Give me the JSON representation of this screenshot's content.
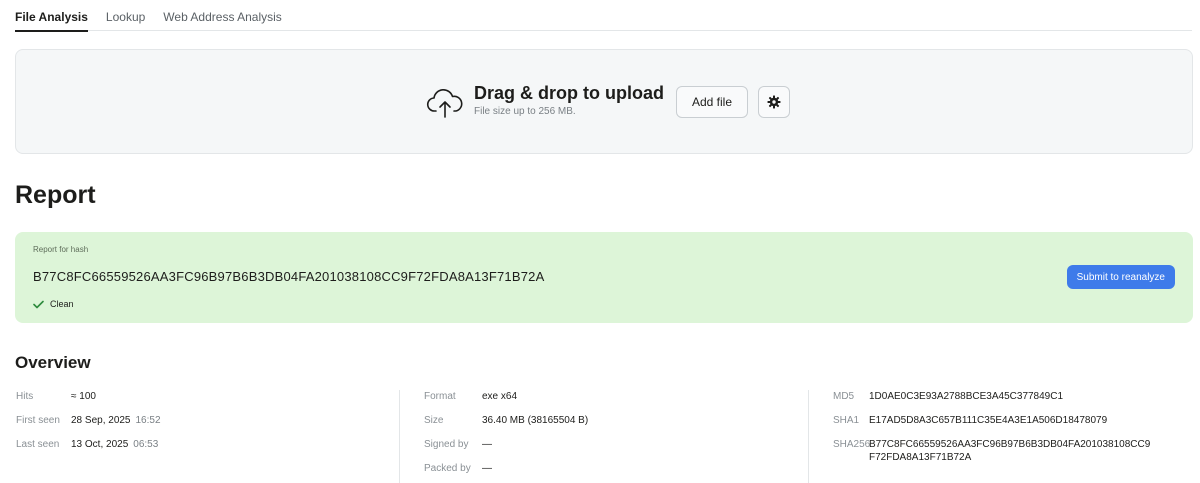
{
  "tabs": [
    {
      "label": "File Analysis",
      "active": true
    },
    {
      "label": "Lookup",
      "active": false
    },
    {
      "label": "Web Address Analysis",
      "active": false
    }
  ],
  "upload": {
    "title": "Drag & drop to upload",
    "subtitle": "File size up to 256 MB.",
    "add_file_label": "Add file",
    "icon": "cloud-upload-icon",
    "settings_icon": "gear-icon"
  },
  "report": {
    "title": "Report",
    "card_label": "Report for hash",
    "hash": "B77C8FC66559526AA3FC96B97B6B3DB04FA201038108CC9F72FDA8A13F71B72A",
    "status": "Clean",
    "reanalyze_label": "Submit to reanalyze",
    "card_color": "#ddf5d8",
    "accent_color": "#3e7bea"
  },
  "overview": {
    "title": "Overview",
    "col1": {
      "hits_label": "Hits",
      "hits_value": "≈ 100",
      "first_seen_label": "First seen",
      "first_seen_date": "28 Sep, 2025",
      "first_seen_time": "16:52",
      "last_seen_label": "Last seen",
      "last_seen_date": "13 Oct, 2025",
      "last_seen_time": "06:53"
    },
    "col2": {
      "format_label": "Format",
      "format_value": "exe x64",
      "size_label": "Size",
      "size_value": "36.40 MB (38165504 B)",
      "signed_label": "Signed by",
      "signed_value": "—",
      "packed_label": "Packed by",
      "packed_value": "—"
    },
    "col3": {
      "md5_label": "MD5",
      "md5_value": "1D0AE0C3E93A2788BCE3A45C377849C1",
      "sha1_label": "SHA1",
      "sha1_value": "E17AD5D8A3C657B111C35E4A3E1A506D18478079",
      "sha256_label": "SHA256",
      "sha256_line1": "B77C8FC66559526AA3FC96B97B6B3DB04FA201038108CC9",
      "sha256_line2": "F72FDA8A13F71B72A"
    }
  }
}
